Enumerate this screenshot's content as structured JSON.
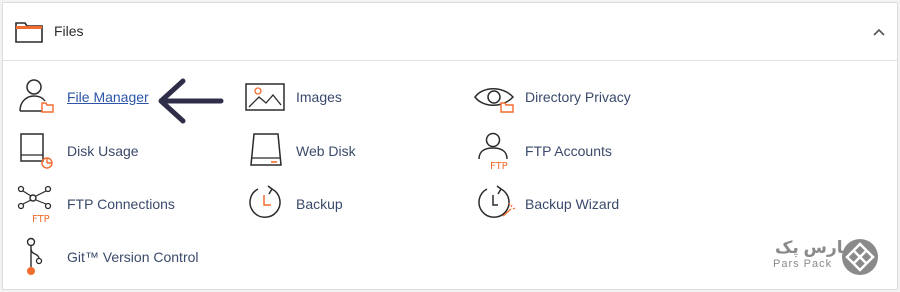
{
  "panel": {
    "title": "Files",
    "collapse_icon": "chevron-up-icon"
  },
  "items": [
    {
      "label": "File Manager",
      "icon": "file-manager-icon"
    },
    {
      "label": "Images",
      "icon": "image-icon"
    },
    {
      "label": "Directory Privacy",
      "icon": "eye-folder-icon"
    },
    {
      "label": "Disk Usage",
      "icon": "disk-usage-icon"
    },
    {
      "label": "Web Disk",
      "icon": "disk-icon"
    },
    {
      "label": "FTP Accounts",
      "icon": "ftp-user-icon"
    },
    {
      "label": "FTP Connections",
      "icon": "ftp-network-icon"
    },
    {
      "label": "Backup",
      "icon": "backup-clock-icon"
    },
    {
      "label": "Backup Wizard",
      "icon": "backup-wizard-icon"
    },
    {
      "label": "Git™ Version Control",
      "icon": "git-branch-icon"
    }
  ],
  "watermark": {
    "logo_text_fa": "پارس پک",
    "logo_text_en": "Pars Pack"
  },
  "colors": {
    "accent_orange": "#f26c2e",
    "icon_dark": "#2b2b2b",
    "link_blue": "#2d55a8",
    "label_blue": "#3a4a6b",
    "arrow": "#2e2e48"
  }
}
